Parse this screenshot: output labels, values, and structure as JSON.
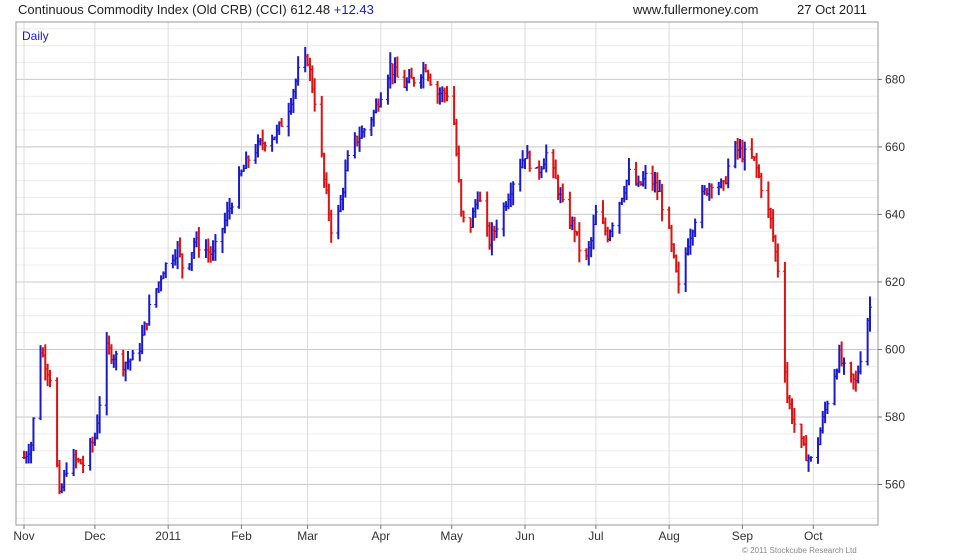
{
  "header": {
    "title": "Continuous Commodity Index (Old CRB) (CCI) 612.48",
    "change": "+12.43",
    "site": "www.fullermoney.com",
    "date": "27 Oct 2011"
  },
  "footer": {
    "copyright": "© 2011 Stockcube Research Ltd"
  },
  "chart_data": {
    "type": "ohlc",
    "interval_label": "Daily",
    "ylim": [
      548,
      697
    ],
    "y_ticks": [
      560,
      580,
      600,
      620,
      640,
      660,
      680
    ],
    "x_labels": [
      {
        "label": "Nov",
        "day": 0
      },
      {
        "label": "Dec",
        "day": 30
      },
      {
        "label": "2011",
        "day": 61
      },
      {
        "label": "Feb",
        "day": 92
      },
      {
        "label": "Mar",
        "day": 120
      },
      {
        "label": "Apr",
        "day": 151
      },
      {
        "label": "May",
        "day": 181
      },
      {
        "label": "Jun",
        "day": 212
      },
      {
        "label": "Jul",
        "day": 242
      },
      {
        "label": "Aug",
        "day": 273
      },
      {
        "label": "Sep",
        "day": 304
      },
      {
        "label": "Oct",
        "day": 334
      }
    ],
    "colors": {
      "up": "#1a1acc",
      "down": "#dd1111",
      "grid": "#dcdcdc"
    },
    "series": [
      {
        "day": 0,
        "value": 568
      },
      {
        "day": 3,
        "value": 572
      },
      {
        "day": 7,
        "value": 600
      },
      {
        "day": 11,
        "value": 592
      },
      {
        "day": 15,
        "value": 556
      },
      {
        "day": 19,
        "value": 568
      },
      {
        "day": 25,
        "value": 566
      },
      {
        "day": 30,
        "value": 574
      },
      {
        "day": 35,
        "value": 600
      },
      {
        "day": 42,
        "value": 596
      },
      {
        "day": 48,
        "value": 598
      },
      {
        "day": 53,
        "value": 612
      },
      {
        "day": 59,
        "value": 624
      },
      {
        "day": 65,
        "value": 630
      },
      {
        "day": 68,
        "value": 622
      },
      {
        "day": 72,
        "value": 632
      },
      {
        "day": 80,
        "value": 628
      },
      {
        "day": 86,
        "value": 640
      },
      {
        "day": 92,
        "value": 652
      },
      {
        "day": 96,
        "value": 658
      },
      {
        "day": 102,
        "value": 662
      },
      {
        "day": 107,
        "value": 664
      },
      {
        "day": 112,
        "value": 672
      },
      {
        "day": 116,
        "value": 682
      },
      {
        "day": 120,
        "value": 686
      },
      {
        "day": 124,
        "value": 670
      },
      {
        "day": 127,
        "value": 650
      },
      {
        "day": 130,
        "value": 636
      },
      {
        "day": 133,
        "value": 640
      },
      {
        "day": 138,
        "value": 660
      },
      {
        "day": 143,
        "value": 664
      },
      {
        "day": 148,
        "value": 670
      },
      {
        "day": 151,
        "value": 676
      },
      {
        "day": 155,
        "value": 684
      },
      {
        "day": 160,
        "value": 678
      },
      {
        "day": 165,
        "value": 680
      },
      {
        "day": 170,
        "value": 684
      },
      {
        "day": 174,
        "value": 676
      },
      {
        "day": 178,
        "value": 676
      },
      {
        "day": 181,
        "value": 676
      },
      {
        "day": 185,
        "value": 640
      },
      {
        "day": 188,
        "value": 634
      },
      {
        "day": 192,
        "value": 646
      },
      {
        "day": 197,
        "value": 632
      },
      {
        "day": 203,
        "value": 642
      },
      {
        "day": 208,
        "value": 652
      },
      {
        "day": 212,
        "value": 658
      },
      {
        "day": 217,
        "value": 652
      },
      {
        "day": 221,
        "value": 658
      },
      {
        "day": 225,
        "value": 650
      },
      {
        "day": 229,
        "value": 640
      },
      {
        "day": 233,
        "value": 636
      },
      {
        "day": 237,
        "value": 624
      },
      {
        "day": 240,
        "value": 632
      },
      {
        "day": 242,
        "value": 640
      },
      {
        "day": 247,
        "value": 634
      },
      {
        "day": 251,
        "value": 642
      },
      {
        "day": 256,
        "value": 652
      },
      {
        "day": 260,
        "value": 648
      },
      {
        "day": 264,
        "value": 652
      },
      {
        "day": 269,
        "value": 646
      },
      {
        "day": 273,
        "value": 634
      },
      {
        "day": 277,
        "value": 618
      },
      {
        "day": 281,
        "value": 632
      },
      {
        "day": 286,
        "value": 644
      },
      {
        "day": 291,
        "value": 650
      },
      {
        "day": 296,
        "value": 648
      },
      {
        "day": 300,
        "value": 660
      },
      {
        "day": 304,
        "value": 658
      },
      {
        "day": 309,
        "value": 656
      },
      {
        "day": 313,
        "value": 646
      },
      {
        "day": 316,
        "value": 638
      },
      {
        "day": 319,
        "value": 624
      },
      {
        "day": 321,
        "value": 604
      },
      {
        "day": 323,
        "value": 586
      },
      {
        "day": 326,
        "value": 578
      },
      {
        "day": 330,
        "value": 570
      },
      {
        "day": 334,
        "value": 566
      },
      {
        "day": 337,
        "value": 576
      },
      {
        "day": 341,
        "value": 588
      },
      {
        "day": 345,
        "value": 598
      },
      {
        "day": 348,
        "value": 592
      },
      {
        "day": 352,
        "value": 590
      },
      {
        "day": 356,
        "value": 606
      },
      {
        "day": 358,
        "value": 612.48
      }
    ]
  }
}
